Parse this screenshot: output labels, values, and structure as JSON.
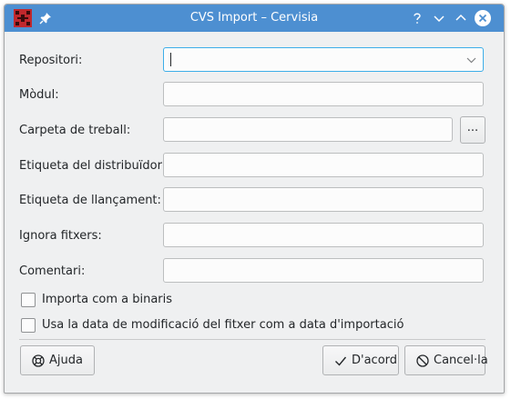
{
  "window": {
    "title": "CVS Import – Cervisia"
  },
  "form": {
    "repository_label": "Repositori:",
    "repository_value": "",
    "module_label": "Mòdul:",
    "module_value": "",
    "working_folder_label": "Carpeta de treball:",
    "working_folder_value": "",
    "browse_label": "...",
    "vendor_tag_label": "Etiqueta del distribuïdor:",
    "vendor_tag_value": "",
    "release_tag_label": "Etiqueta de llançament:",
    "release_tag_value": "",
    "ignore_files_label": "Ignora fitxers:",
    "ignore_files_value": "",
    "comment_label": "Comentari:",
    "comment_value": "",
    "import_binary_label": "Importa com a binaris",
    "import_binary_checked": false,
    "use_file_date_label": "Usa la data de modificació del fitxer com a data d'importació",
    "use_file_date_checked": false
  },
  "buttons": {
    "help_label": "Ajuda",
    "ok_label": "D'acord",
    "cancel_label": "Cancel·la"
  },
  "colors": {
    "titlebar": "#4d8fd1",
    "focus": "#3daee9",
    "app_icon": "#c0282d"
  },
  "icons": {
    "app": "cervisia-icon",
    "pin": "pin-icon",
    "help": "help-question-icon",
    "minimize": "chevron-down-icon",
    "maximize": "chevron-up-icon",
    "close": "close-icon",
    "help_button": "lifebuoy-icon",
    "ok_button": "checkmark-icon",
    "cancel_button": "cancel-circle-icon"
  }
}
